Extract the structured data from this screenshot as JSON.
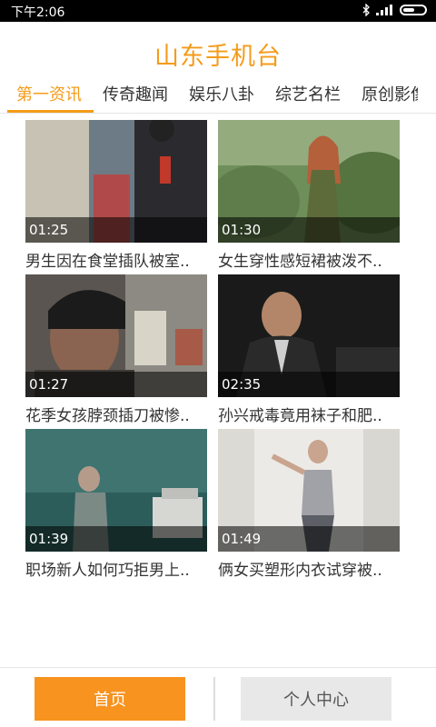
{
  "status_bar": {
    "time": "下午2:06",
    "icons": [
      "bluetooth-icon",
      "signal-icon",
      "battery-icon"
    ]
  },
  "header": {
    "title": "山东手机台"
  },
  "tabs": [
    {
      "label": "第一资讯",
      "active": true
    },
    {
      "label": "传奇趣闻",
      "active": false
    },
    {
      "label": "娱乐八卦",
      "active": false
    },
    {
      "label": "综艺名栏",
      "active": false
    },
    {
      "label": "原创影像",
      "active": false
    }
  ],
  "videos": [
    {
      "duration": "01:25",
      "title": "男生因在食堂插队被室.."
    },
    {
      "duration": "01:30",
      "title": "女生穿性感短裙被泼不.."
    },
    {
      "duration": "01:27",
      "title": "花季女孩脖颈插刀被惨.."
    },
    {
      "duration": "02:35",
      "title": "孙兴戒毒竟用袜子和肥.."
    },
    {
      "duration": "01:39",
      "title": "职场新人如何巧拒男上.."
    },
    {
      "duration": "01:49",
      "title": "俩女买塑形内衣试穿被.."
    }
  ],
  "bottom_nav": {
    "home_label": "首页",
    "profile_label": "个人中心"
  },
  "colors": {
    "accent": "#f49b1a",
    "home_button_bg": "#f7931e",
    "profile_button_bg": "#e8e8e8"
  }
}
